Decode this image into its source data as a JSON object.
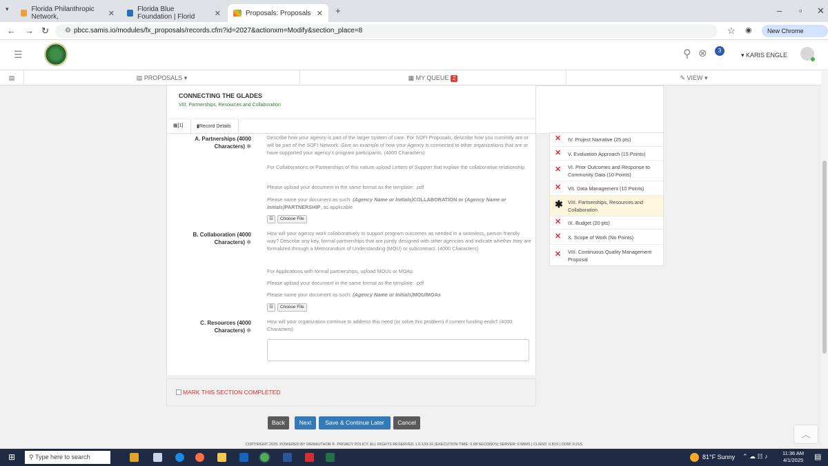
{
  "browser": {
    "tabs": [
      {
        "label": "Florida Philanthropic Network,"
      },
      {
        "label": "Florida Blue Foundation | Florid"
      },
      {
        "label": "Proposals: Proposals"
      }
    ],
    "url": "pbcc.samis.io/modules/fx_proposals/records.cfm?id=2027&actionxm=Modify&section_place=8",
    "new_chrome": "New Chrome available"
  },
  "header": {
    "notification_count": "3",
    "user_name": "KARIS ENGLE"
  },
  "menubar": {
    "proposals": "PROPOSALS",
    "my_queue": "MY QUEUE",
    "queue_badge": "2",
    "view": "VIEW"
  },
  "record": {
    "project_title": "CONNECTING THE GLADES",
    "section": "VIII. Partnerships, Resources and Collaboration",
    "tab_count": "[1]",
    "tab_details": "Record Details"
  },
  "fields": {
    "partnerships": {
      "label": "A. Partnerships (4000 Characters)",
      "desc": "Describe how your agency is part of the larger system of care. For SOFI Proposals, describe how you currently are or will be part of the SOFI Network. Give an example of how your Agency is connected to other organizations that are or have supported your agency's program participants. (4000 Characters)",
      "note1": "For Collaborations or Partnerships of this nature upload Letters of Support that explain the collaborative relationship.",
      "note2": "Please upload your document in the same format as the template: .pdf",
      "note3_a": "Please name your document as such: ",
      "note3_b": "(Agency Name or Initials)",
      "note3_c": "COLLABORATION or ",
      "note3_d": "(Agency Name or Initials)",
      "note3_e": "PARTNERSHIP",
      "note3_f": ", as applicable",
      "choose_file": "Choose File"
    },
    "collaboration": {
      "label": "B. Collaboration (4000 Characters)",
      "desc": "How will your agency work collaboratively to support program outcomes as needed in a seamless, person friendly way? Describe any key, formal partnerships that are jointly designed with other agencies and indicate whether they are formalized through a Memorandum of Understanding (MOU) or subcontract. (4000 Characters)",
      "note1": "For Applications with formal partnerships, upload MOUs or MOAs.",
      "note2": "Please upload your document in the same format as the template: .pdf",
      "note3_a": "Please name your document as such: ",
      "note3_b": "(Agency Name or Initials)",
      "note3_c": "MOU/MOAs",
      "choose_file": "Choose File"
    },
    "resources": {
      "label": "C. Resources (4000 Characters)",
      "desc": "How will your organization continue to address this need (or solve this problem) if current funding ends? (4000 Characters)",
      "value": ""
    }
  },
  "sections": [
    {
      "label": "IV. Project Narrative (25 pts)",
      "status": "incomplete"
    },
    {
      "label": "V. Evaluation Approach (15 Points)",
      "status": "incomplete"
    },
    {
      "label": "VI. Prior Outcomes and Response to Community Data (10 Points)",
      "status": "incomplete"
    },
    {
      "label": "VII. Data Management (10 Points)",
      "status": "incomplete"
    },
    {
      "label": "VIII. Partnerships, Resources and Collaboration",
      "status": "current"
    },
    {
      "label": "IX. Budget (20 pts)",
      "status": "incomplete"
    },
    {
      "label": "X. Scope of Work (No Points)",
      "status": "incomplete"
    },
    {
      "label": "VIII. Continuous Quality Management Proposal",
      "status": "incomplete"
    }
  ],
  "mark_completed": "MARK THIS SECTION COMPLETED",
  "buttons": {
    "back": "Back",
    "next": "Next",
    "save": "Save & Continue Later",
    "cancel": "Cancel"
  },
  "footer": "COPYRIGHT 2025. POWERED BY WEBAUTHOR ®. PRIVACY POLICY. ALL RIGHTS RESERVED. LX-133-16 (EXECUTION TIME: 0.68 SECONDS) SERVER: 0.68MS | CLIENT: 0.81S | DOM: 0.01S",
  "taskbar": {
    "search_placeholder": "Type here to search",
    "weather": "81°F  Sunny",
    "time": "11:36 AM",
    "date": "4/1/2025"
  },
  "colors": {
    "accent_blue": "#337ab7",
    "gray_button": "#5a5a5a",
    "incomplete_mark": "#d32f2f",
    "current_highlight": "#fdf6dc"
  }
}
